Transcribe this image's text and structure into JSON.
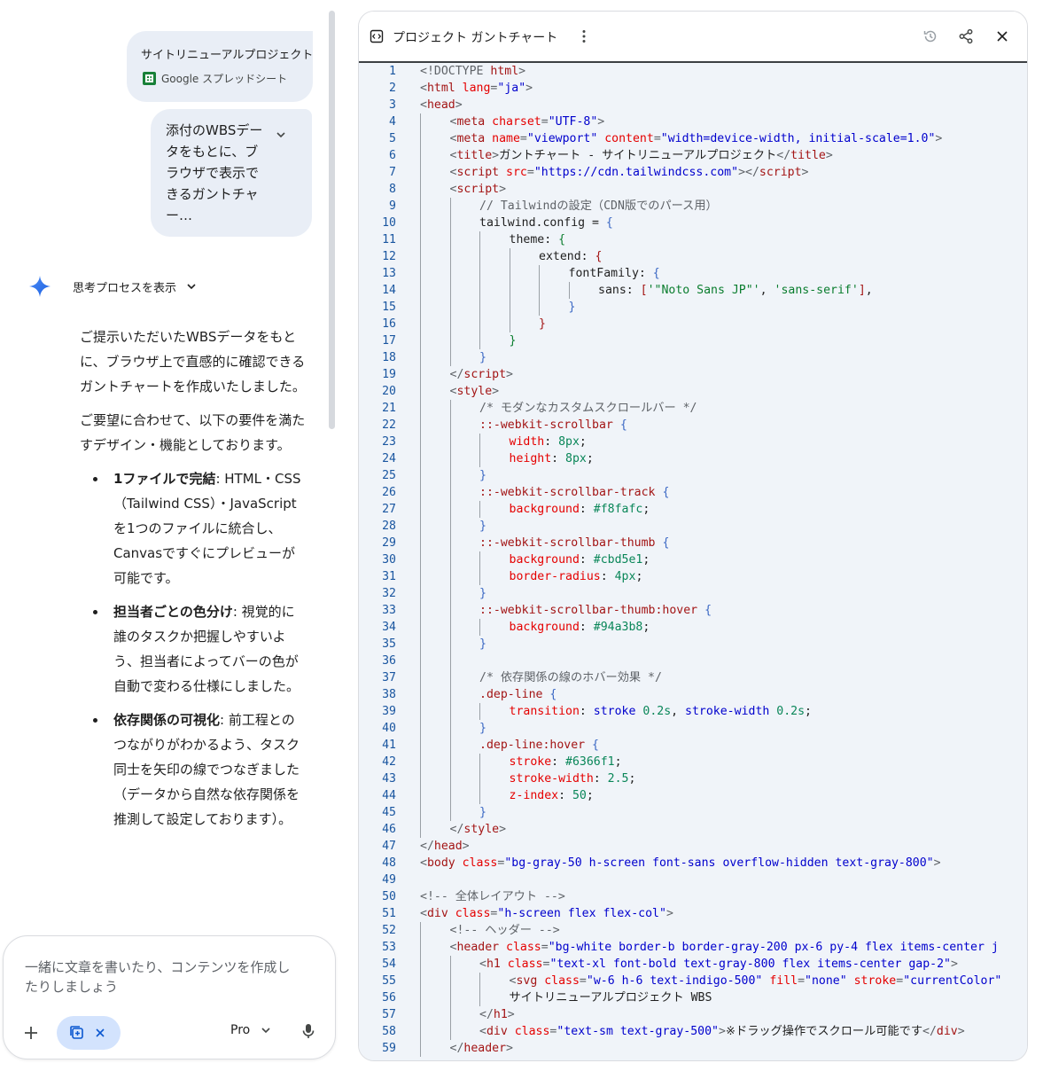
{
  "chat": {
    "attachment": {
      "title": "サイトリニューアルプロジェクト",
      "type_label": "Google スプレッドシート"
    },
    "prompt": {
      "text": "添付のWBSデータをもとに、ブラウザで表示できるガントチャー…"
    },
    "thinking": {
      "label": "思考プロセスを表示"
    },
    "answer": {
      "para1": "ご提示いただいたWBSデータをもとに、ブラウザ上で直感的に確認できるガントチャートを作成いたしました。",
      "para2": "ご要望に合わせて、以下の要件を満たすデザイン・機能としております。",
      "bullets": [
        {
          "title": "1ファイルで完結",
          "text": ": HTML・CSS（Tailwind CSS）・JavaScriptを1つのファイルに統合し、Canvasですぐにプレビューが可能です。"
        },
        {
          "title": "担当者ごとの色分け",
          "text": ": 視覚的に誰のタスクか把握しやすいよう、担当者によってバーの色が自動で変わる仕様にしました。"
        },
        {
          "title": "依存関係の可視化",
          "text": ": 前工程とのつながりがわかるよう、タスク同士を矢印の線でつなぎました（データから自然な依存関係を推測して設定しております）。"
        }
      ]
    },
    "input": {
      "placeholder": "一緒に文章を書いたり、コンテンツを作成したりしましょう",
      "model": "Pro"
    }
  },
  "canvas": {
    "title": "プロジェクト ガントチャート",
    "code_lines": [
      {
        "n": "1",
        "i": 0,
        "s": [
          [
            "t-p",
            "<!DOCTYPE "
          ],
          [
            "t-tag",
            "html"
          ],
          [
            "t-p",
            ">"
          ]
        ]
      },
      {
        "n": "2",
        "i": 0,
        "s": [
          [
            "t-p",
            "<"
          ],
          [
            "t-tag",
            "html"
          ],
          [
            "t-at",
            " lang"
          ],
          [
            "t-p",
            "="
          ],
          [
            "t-val",
            "\"ja\""
          ],
          [
            "t-p",
            ">"
          ]
        ]
      },
      {
        "n": "3",
        "i": 0,
        "s": [
          [
            "t-p",
            "<"
          ],
          [
            "t-tag",
            "head"
          ],
          [
            "t-p",
            ">"
          ]
        ]
      },
      {
        "n": "4",
        "i": 1,
        "s": [
          [
            "t-p",
            "<"
          ],
          [
            "t-tag",
            "meta"
          ],
          [
            "t-at",
            " charset"
          ],
          [
            "t-p",
            "="
          ],
          [
            "t-val",
            "\"UTF-8\""
          ],
          [
            "t-p",
            ">"
          ]
        ]
      },
      {
        "n": "5",
        "i": 1,
        "s": [
          [
            "t-p",
            "<"
          ],
          [
            "t-tag",
            "meta"
          ],
          [
            "t-at",
            " name"
          ],
          [
            "t-p",
            "="
          ],
          [
            "t-val",
            "\"viewport\""
          ],
          [
            "t-at",
            " content"
          ],
          [
            "t-p",
            "="
          ],
          [
            "t-val",
            "\"width=device-width, initial-scale=1.0\""
          ],
          [
            "t-p",
            ">"
          ]
        ]
      },
      {
        "n": "6",
        "i": 1,
        "s": [
          [
            "t-p",
            "<"
          ],
          [
            "t-tag",
            "title"
          ],
          [
            "t-p",
            ">"
          ],
          [
            "t-pl",
            "ガントチャート - サイトリニューアルプロジェクト"
          ],
          [
            "t-p",
            "</"
          ],
          [
            "t-tag",
            "title"
          ],
          [
            "t-p",
            ">"
          ]
        ]
      },
      {
        "n": "7",
        "i": 1,
        "s": [
          [
            "t-p",
            "<"
          ],
          [
            "t-tag",
            "script"
          ],
          [
            "t-at",
            " src"
          ],
          [
            "t-p",
            "="
          ],
          [
            "t-val",
            "\"https://cdn.tailwindcss.com\""
          ],
          [
            "t-p",
            "></"
          ],
          [
            "t-tag",
            "script"
          ],
          [
            "t-p",
            ">"
          ]
        ]
      },
      {
        "n": "8",
        "i": 1,
        "s": [
          [
            "t-p",
            "<"
          ],
          [
            "t-tag",
            "script"
          ],
          [
            "t-p",
            ">"
          ]
        ]
      },
      {
        "n": "9",
        "i": 2,
        "s": [
          [
            "t-com",
            "// Tailwindの設定（CDN版でのパース用）"
          ]
        ]
      },
      {
        "n": "10",
        "i": 2,
        "s": [
          [
            "t-pl",
            "tailwind.config = "
          ],
          [
            "t-br",
            "{"
          ]
        ]
      },
      {
        "n": "11",
        "i": 3,
        "s": [
          [
            "t-pl",
            "theme: "
          ],
          [
            "t-str",
            "{"
          ]
        ]
      },
      {
        "n": "12",
        "i": 4,
        "s": [
          [
            "t-pl",
            "extend: "
          ],
          [
            "t-tag",
            "{"
          ]
        ]
      },
      {
        "n": "13",
        "i": 5,
        "s": [
          [
            "t-pl",
            "fontFamily: "
          ],
          [
            "t-br",
            "{"
          ]
        ]
      },
      {
        "n": "14",
        "i": 6,
        "s": [
          [
            "t-pl",
            "sans: "
          ],
          [
            "t-tag",
            "["
          ],
          [
            "t-str",
            "'\"Noto Sans JP\"'"
          ],
          [
            "t-pl",
            ", "
          ],
          [
            "t-str",
            "'sans-serif'"
          ],
          [
            "t-tag",
            "]"
          ],
          [
            "t-pl",
            ","
          ]
        ]
      },
      {
        "n": "15",
        "i": 5,
        "s": [
          [
            "t-br",
            "}"
          ]
        ]
      },
      {
        "n": "16",
        "i": 4,
        "s": [
          [
            "t-tag",
            "}"
          ]
        ]
      },
      {
        "n": "17",
        "i": 3,
        "s": [
          [
            "t-str",
            "}"
          ]
        ]
      },
      {
        "n": "18",
        "i": 2,
        "s": [
          [
            "t-br",
            "}"
          ]
        ]
      },
      {
        "n": "19",
        "i": 1,
        "s": [
          [
            "t-p",
            "</"
          ],
          [
            "t-tag",
            "script"
          ],
          [
            "t-p",
            ">"
          ]
        ]
      },
      {
        "n": "20",
        "i": 1,
        "s": [
          [
            "t-p",
            "<"
          ],
          [
            "t-tag",
            "style"
          ],
          [
            "t-p",
            ">"
          ]
        ]
      },
      {
        "n": "21",
        "i": 2,
        "s": [
          [
            "t-com",
            "/* モダンなカスタムスクロールバー */"
          ]
        ]
      },
      {
        "n": "22",
        "i": 2,
        "s": [
          [
            "t-tag",
            "::-webkit-scrollbar"
          ],
          [
            "t-pl",
            " "
          ],
          [
            "t-br",
            "{"
          ]
        ]
      },
      {
        "n": "23",
        "i": 3,
        "s": [
          [
            "t-at",
            "width"
          ],
          [
            "t-pl",
            ": "
          ],
          [
            "t-num",
            "8px"
          ],
          [
            "t-pl",
            ";"
          ]
        ]
      },
      {
        "n": "24",
        "i": 3,
        "s": [
          [
            "t-at",
            "height"
          ],
          [
            "t-pl",
            ": "
          ],
          [
            "t-num",
            "8px"
          ],
          [
            "t-pl",
            ";"
          ]
        ]
      },
      {
        "n": "25",
        "i": 2,
        "s": [
          [
            "t-br",
            "}"
          ]
        ]
      },
      {
        "n": "26",
        "i": 2,
        "s": [
          [
            "t-tag",
            "::-webkit-scrollbar-track"
          ],
          [
            "t-pl",
            " "
          ],
          [
            "t-br",
            "{"
          ]
        ]
      },
      {
        "n": "27",
        "i": 3,
        "s": [
          [
            "t-at",
            "background"
          ],
          [
            "t-pl",
            ": "
          ],
          [
            "t-num",
            "#f8fafc"
          ],
          [
            "t-pl",
            ";"
          ]
        ]
      },
      {
        "n": "28",
        "i": 2,
        "s": [
          [
            "t-br",
            "}"
          ]
        ]
      },
      {
        "n": "29",
        "i": 2,
        "s": [
          [
            "t-tag",
            "::-webkit-scrollbar-thumb"
          ],
          [
            "t-pl",
            " "
          ],
          [
            "t-br",
            "{"
          ]
        ]
      },
      {
        "n": "30",
        "i": 3,
        "s": [
          [
            "t-at",
            "background"
          ],
          [
            "t-pl",
            ": "
          ],
          [
            "t-num",
            "#cbd5e1"
          ],
          [
            "t-pl",
            ";"
          ]
        ]
      },
      {
        "n": "31",
        "i": 3,
        "s": [
          [
            "t-at",
            "border-radius"
          ],
          [
            "t-pl",
            ": "
          ],
          [
            "t-num",
            "4px"
          ],
          [
            "t-pl",
            ";"
          ]
        ]
      },
      {
        "n": "32",
        "i": 2,
        "s": [
          [
            "t-br",
            "}"
          ]
        ]
      },
      {
        "n": "33",
        "i": 2,
        "s": [
          [
            "t-tag",
            "::-webkit-scrollbar-thumb:hover"
          ],
          [
            "t-pl",
            " "
          ],
          [
            "t-br",
            "{"
          ]
        ]
      },
      {
        "n": "34",
        "i": 3,
        "s": [
          [
            "t-at",
            "background"
          ],
          [
            "t-pl",
            ": "
          ],
          [
            "t-num",
            "#94a3b8"
          ],
          [
            "t-pl",
            ";"
          ]
        ]
      },
      {
        "n": "35",
        "i": 2,
        "s": [
          [
            "t-br",
            "}"
          ]
        ]
      },
      {
        "n": "36",
        "i": 2,
        "s": []
      },
      {
        "n": "37",
        "i": 2,
        "s": [
          [
            "t-com",
            "/* 依存関係の線のホバー効果 */"
          ]
        ]
      },
      {
        "n": "38",
        "i": 2,
        "s": [
          [
            "t-tag",
            ".dep-line"
          ],
          [
            "t-pl",
            " "
          ],
          [
            "t-br",
            "{"
          ]
        ]
      },
      {
        "n": "39",
        "i": 3,
        "s": [
          [
            "t-at",
            "transition"
          ],
          [
            "t-pl",
            ": "
          ],
          [
            "t-val",
            "stroke"
          ],
          [
            "t-pl",
            " "
          ],
          [
            "t-num",
            "0.2s"
          ],
          [
            "t-pl",
            ", "
          ],
          [
            "t-val",
            "stroke-width"
          ],
          [
            "t-pl",
            " "
          ],
          [
            "t-num",
            "0.2s"
          ],
          [
            "t-pl",
            ";"
          ]
        ]
      },
      {
        "n": "40",
        "i": 2,
        "s": [
          [
            "t-br",
            "}"
          ]
        ]
      },
      {
        "n": "41",
        "i": 2,
        "s": [
          [
            "t-tag",
            ".dep-line:hover"
          ],
          [
            "t-pl",
            " "
          ],
          [
            "t-br",
            "{"
          ]
        ]
      },
      {
        "n": "42",
        "i": 3,
        "s": [
          [
            "t-at",
            "stroke"
          ],
          [
            "t-pl",
            ": "
          ],
          [
            "t-num",
            "#6366f1"
          ],
          [
            "t-pl",
            ";"
          ]
        ]
      },
      {
        "n": "43",
        "i": 3,
        "s": [
          [
            "t-at",
            "stroke-width"
          ],
          [
            "t-pl",
            ": "
          ],
          [
            "t-num",
            "2.5"
          ],
          [
            "t-pl",
            ";"
          ]
        ]
      },
      {
        "n": "44",
        "i": 3,
        "s": [
          [
            "t-at",
            "z-index"
          ],
          [
            "t-pl",
            ": "
          ],
          [
            "t-num",
            "50"
          ],
          [
            "t-pl",
            ";"
          ]
        ]
      },
      {
        "n": "45",
        "i": 2,
        "s": [
          [
            "t-br",
            "}"
          ]
        ]
      },
      {
        "n": "46",
        "i": 1,
        "s": [
          [
            "t-p",
            "</"
          ],
          [
            "t-tag",
            "style"
          ],
          [
            "t-p",
            ">"
          ]
        ]
      },
      {
        "n": "47",
        "i": 0,
        "s": [
          [
            "t-p",
            "</"
          ],
          [
            "t-tag",
            "head"
          ],
          [
            "t-p",
            ">"
          ]
        ]
      },
      {
        "n": "48",
        "i": 0,
        "s": [
          [
            "t-p",
            "<"
          ],
          [
            "t-tag",
            "body"
          ],
          [
            "t-at",
            " class"
          ],
          [
            "t-p",
            "="
          ],
          [
            "t-val",
            "\"bg-gray-50 h-screen font-sans overflow-hidden text-gray-800\""
          ],
          [
            "t-p",
            ">"
          ]
        ]
      },
      {
        "n": "49",
        "i": 0,
        "s": []
      },
      {
        "n": "50",
        "i": 0,
        "s": [
          [
            "t-com",
            "<!-- 全体レイアウト -->"
          ]
        ]
      },
      {
        "n": "51",
        "i": 0,
        "s": [
          [
            "t-p",
            "<"
          ],
          [
            "t-tag",
            "div"
          ],
          [
            "t-at",
            " class"
          ],
          [
            "t-p",
            "="
          ],
          [
            "t-val",
            "\"h-screen flex flex-col\""
          ],
          [
            "t-p",
            ">"
          ]
        ]
      },
      {
        "n": "52",
        "i": 1,
        "s": [
          [
            "t-com",
            "<!-- ヘッダー -->"
          ]
        ]
      },
      {
        "n": "53",
        "i": 1,
        "s": [
          [
            "t-p",
            "<"
          ],
          [
            "t-tag",
            "header"
          ],
          [
            "t-at",
            " class"
          ],
          [
            "t-p",
            "="
          ],
          [
            "t-val",
            "\"bg-white border-b border-gray-200 px-6 py-4 flex items-center j"
          ]
        ]
      },
      {
        "n": "54",
        "i": 2,
        "s": [
          [
            "t-p",
            "<"
          ],
          [
            "t-tag",
            "h1"
          ],
          [
            "t-at",
            " class"
          ],
          [
            "t-p",
            "="
          ],
          [
            "t-val",
            "\"text-xl font-bold text-gray-800 flex items-center gap-2\""
          ],
          [
            "t-p",
            ">"
          ]
        ]
      },
      {
        "n": "55",
        "i": 3,
        "s": [
          [
            "t-p",
            "<"
          ],
          [
            "t-tag",
            "svg"
          ],
          [
            "t-at",
            " class"
          ],
          [
            "t-p",
            "="
          ],
          [
            "t-val",
            "\"w-6 h-6 text-indigo-500\""
          ],
          [
            "t-at",
            " fill"
          ],
          [
            "t-p",
            "="
          ],
          [
            "t-val",
            "\"none\""
          ],
          [
            "t-at",
            " stroke"
          ],
          [
            "t-p",
            "="
          ],
          [
            "t-val",
            "\"currentColor\""
          ]
        ]
      },
      {
        "n": "56",
        "i": 3,
        "s": [
          [
            "t-pl",
            "サイトリニューアルプロジェクト WBS"
          ]
        ]
      },
      {
        "n": "57",
        "i": 2,
        "s": [
          [
            "t-p",
            "</"
          ],
          [
            "t-tag",
            "h1"
          ],
          [
            "t-p",
            ">"
          ]
        ]
      },
      {
        "n": "58",
        "i": 2,
        "s": [
          [
            "t-p",
            "<"
          ],
          [
            "t-tag",
            "div"
          ],
          [
            "t-at",
            " class"
          ],
          [
            "t-p",
            "="
          ],
          [
            "t-val",
            "\"text-sm text-gray-500\""
          ],
          [
            "t-p",
            ">"
          ],
          [
            "t-pl",
            "※ドラッグ操作でスクロール可能です"
          ],
          [
            "t-p",
            "</"
          ],
          [
            "t-tag",
            "div"
          ],
          [
            "t-p",
            ">"
          ]
        ]
      },
      {
        "n": "59",
        "i": 1,
        "s": [
          [
            "t-p",
            "</"
          ],
          [
            "t-tag",
            "header"
          ],
          [
            "t-p",
            ">"
          ]
        ]
      }
    ]
  }
}
